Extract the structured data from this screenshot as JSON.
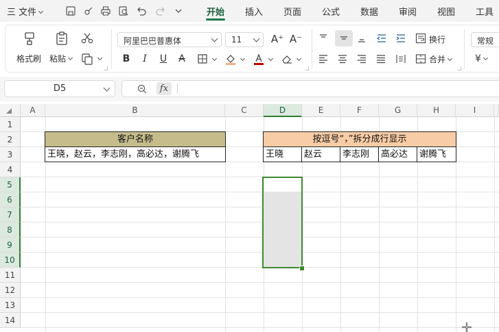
{
  "topbar": {
    "file_menu": "三 文件",
    "tabs": [
      "开始",
      "插入",
      "页面",
      "公式",
      "数据",
      "审阅",
      "视图",
      "工具"
    ]
  },
  "ribbon": {
    "format_painter": "格式刷",
    "paste": "粘贴",
    "font_name": "阿里巴巴普惠体",
    "font_size": "11",
    "wrap_text": "换行",
    "merge": "合并",
    "number_format": "常规",
    "currency_symbol": "¥"
  },
  "formula_bar": {
    "name_box": "D5",
    "fx_label": "fx",
    "formula": ""
  },
  "sheet": {
    "columns": [
      "A",
      "B",
      "C",
      "D",
      "E",
      "F",
      "G",
      "H",
      "I"
    ],
    "rows": [
      "1",
      "2",
      "3",
      "4",
      "5",
      "6",
      "7",
      "8",
      "9",
      "10",
      "11",
      "12",
      "13",
      "14"
    ],
    "b2_header": "客户名称",
    "b3_value": "王晓，赵云，李志刚，高必达，谢腾飞",
    "d2_header": "按逗号“，”拆分成行显示",
    "split_values": [
      "王晓",
      "赵云",
      "李志刚",
      "高必达",
      "谢腾飞"
    ]
  },
  "colors": {
    "accent_green": "#1f7a4d",
    "header_b_fill": "#c6bc8b",
    "header_d_fill": "#f8cca6",
    "selection_border": "#3d8b2e",
    "selection_fill": "#e4e4e4"
  }
}
